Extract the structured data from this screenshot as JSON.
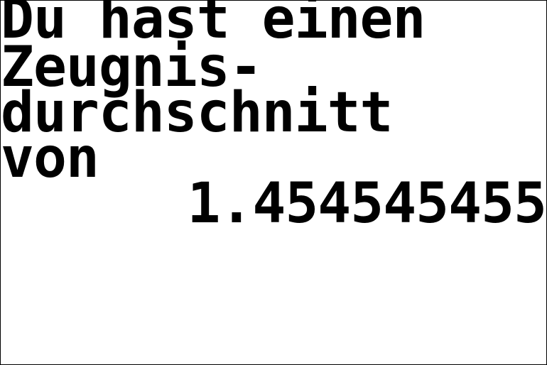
{
  "screen": {
    "lines": [
      "Du hast einen",
      "Zeugnis-",
      "durchschnitt",
      "von",
      "1.454545455"
    ],
    "busy_indicator": "⋮"
  }
}
